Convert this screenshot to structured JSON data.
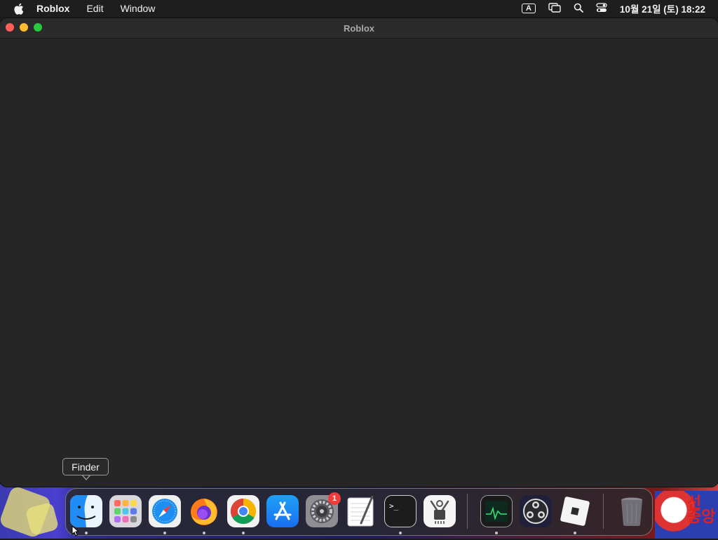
{
  "menubar": {
    "app_name": "Roblox",
    "items": [
      "Edit",
      "Window"
    ],
    "input_method": "A",
    "clock": "10월 21일 (토) 18:22"
  },
  "window": {
    "title": "Roblox"
  },
  "tooltip": {
    "text": "Finder"
  },
  "dock": {
    "icons": [
      "finder-icon",
      "launchpad-icon",
      "safari-icon",
      "firefox-icon",
      "chrome-icon",
      "app-store-icon",
      "system-settings-icon",
      "textedit-icon",
      "terminal-icon",
      "system-information-icon",
      "activity-monitor-icon",
      "obs-icon",
      "roblox-icon",
      "trash-icon"
    ],
    "settings_badge": "1"
  },
  "colors": {
    "menubar_bg": "#1e1e1e",
    "window_bg": "#262626",
    "close": "#fe5f57",
    "minimize": "#febb2e",
    "maximize": "#28c840",
    "badge": "#f23b3b"
  }
}
